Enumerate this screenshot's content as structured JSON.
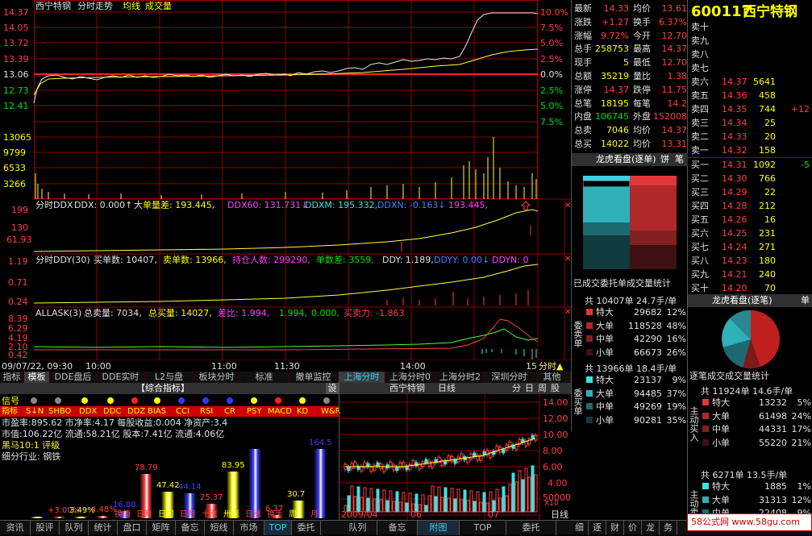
{
  "chart_title": {
    "name": "西宁特钢",
    "mode": "分时走势",
    "avg": "均线",
    "vol": "成交量"
  },
  "price_axis": [
    "14.37",
    "14.05",
    "13.72",
    "13.39",
    "13.06",
    "12.73",
    "12.41"
  ],
  "pct_axis": [
    "10.0%",
    "7.5%",
    "5.0%",
    "2.5%",
    "0.0%",
    "2.5%",
    "5.0%",
    "7.5%"
  ],
  "vol_axis": [
    "13065",
    "9799",
    "6533",
    "3266"
  ],
  "ddx_head": {
    "t": "分时DDX",
    "a": "DDX: 0.000↑",
    "b": "大单量差: 193.445,",
    "c": "DDX60: 131.731↓",
    "d": "DDXM: 195.332,",
    "e": "DDXN: -0.163↓",
    "f": "193.445,"
  },
  "ddx_axis": [
    "199",
    "130",
    "61.93"
  ],
  "ddy_head": {
    "t": "分时DDY(30)",
    "a": "买单数: 10407,",
    "b": "卖单数: 13966,",
    "c": "持仓人数: 299290,",
    "d": "单数差: 3559,",
    "e": "DDY: 1.189,",
    "f": "DDYY: 0.00↓",
    "g": "DDYN: 0"
  },
  "ddy_axis": [
    "1.19",
    "0.71",
    "0.24"
  ],
  "allask_head": {
    "t": "ALLASK(3)",
    "a": "总卖量: 7034,",
    "b": "总买量: 14027,",
    "c": "差比: 1.994,",
    "d": "1.994,",
    "e": "0.000,",
    "f": "买卖力: -1.863"
  },
  "allask_axis": [
    "8.39",
    "6.29",
    "4.19",
    "2.10",
    "0.42"
  ],
  "time_axis": {
    "date": "09/07/22, 09:30",
    "t1": "10:00",
    "t2": "11:00",
    "t3": "11:30",
    "t4": "14:00",
    "t5": "15",
    "end": "分时▲"
  },
  "tabs": [
    "指标",
    "模板",
    "DDE盘后",
    "DDE实时",
    "L2与盘",
    "板块分时",
    "标准",
    "撤单监控",
    "上海分时",
    "上海分时0",
    "上海分时2",
    "深圳分时",
    "其他"
  ],
  "quote": [
    {
      "a": "最新",
      "b": "14.33",
      "c": "均价",
      "d": "13.61"
    },
    {
      "a": "涨跌",
      "b": "+1.27",
      "c": "换手",
      "d": "6.37%"
    },
    {
      "a": "涨幅",
      "b": "9.72%",
      "c": "今开",
      "d": "12.70"
    },
    {
      "a": "总手",
      "b": "258753",
      "c": "最高",
      "d": "14.37"
    },
    {
      "a": "现手",
      "b": "5",
      "c": "最低",
      "d": "12.70"
    },
    {
      "a": "总额",
      "b": "35219",
      "c": "量比",
      "d": "1.38"
    },
    {
      "a": "涨停",
      "b": "14.37",
      "c": "跌停",
      "d": "11.75"
    },
    {
      "a": "总笔",
      "b": "18195",
      "c": "每笔",
      "d": "14.2"
    },
    {
      "a": "内盘",
      "b": "106745",
      "c": "外盘",
      "d": "152008"
    },
    {
      "a": "总卖",
      "b": "7046",
      "c": "均价",
      "d": "14.37"
    },
    {
      "a": "总买",
      "b": "14022",
      "c": "均价",
      "d": "13.31"
    }
  ],
  "stock": {
    "code": "600117",
    "name": "西宁特钢"
  },
  "sells": [
    {
      "l": "卖十",
      "p": "",
      "v": "",
      "x": ""
    },
    {
      "l": "卖九",
      "p": "",
      "v": "",
      "x": ""
    },
    {
      "l": "卖八",
      "p": "",
      "v": "",
      "x": ""
    },
    {
      "l": "卖七",
      "p": "",
      "v": "",
      "x": ""
    },
    {
      "l": "卖六",
      "p": "14.37",
      "v": "5641",
      "x": ""
    },
    {
      "l": "卖五",
      "p": "14.36",
      "v": "458",
      "x": ""
    },
    {
      "l": "卖四",
      "p": "14.35",
      "v": "744",
      "x": "+12"
    },
    {
      "l": "卖三",
      "p": "14.34",
      "v": "25",
      "x": ""
    },
    {
      "l": "卖二",
      "p": "14.33",
      "v": "20",
      "x": ""
    },
    {
      "l": "卖一",
      "p": "14.32",
      "v": "158",
      "x": ""
    }
  ],
  "buys": [
    {
      "l": "买一",
      "p": "14.31",
      "v": "1092",
      "x": "-5"
    },
    {
      "l": "买二",
      "p": "14.30",
      "v": "766",
      "x": ""
    },
    {
      "l": "买三",
      "p": "14.29",
      "v": "22",
      "x": ""
    },
    {
      "l": "买四",
      "p": "14.28",
      "v": "212",
      "x": ""
    },
    {
      "l": "买五",
      "p": "14.26",
      "v": "16",
      "x": ""
    },
    {
      "l": "买六",
      "p": "14.25",
      "v": "231",
      "x": ""
    },
    {
      "l": "买七",
      "p": "14.24",
      "v": "271",
      "x": ""
    },
    {
      "l": "买八",
      "p": "14.23",
      "v": "180",
      "x": ""
    },
    {
      "l": "买九",
      "p": "14.21",
      "v": "240",
      "x": ""
    },
    {
      "l": "买十",
      "p": "14.20",
      "v": "70",
      "x": ""
    }
  ],
  "dragon1": {
    "title": "龙虎看盘(逐单)",
    "tab": "饼",
    "tab2": "笔",
    "caption": "已成交委托单成交量统计"
  },
  "sell_orders": {
    "side": "委卖单",
    "head": "共 10407单 24.7手/单",
    "rows": [
      {
        "n": "特大",
        "v": "29682",
        "p": "12%"
      },
      {
        "n": "大单",
        "v": "118528",
        "p": "48%"
      },
      {
        "n": "中单",
        "v": "42290",
        "p": "16%"
      },
      {
        "n": "小单",
        "v": "66673",
        "p": "26%"
      }
    ]
  },
  "buy_orders": {
    "side": "委买单",
    "head": "共 13966单 18.4手/单",
    "rows": [
      {
        "n": "特大",
        "v": "23137",
        "p": "9%"
      },
      {
        "n": "大单",
        "v": "94485",
        "p": "37%"
      },
      {
        "n": "中单",
        "v": "49269",
        "p": "19%"
      },
      {
        "n": "小单",
        "v": "90281",
        "p": "35%"
      }
    ]
  },
  "dragon2": {
    "title": "龙虎看盘(逐笔)",
    "tab": "单",
    "caption": "逐笔成交成交量统计"
  },
  "active_buy": {
    "side": "主动买入",
    "head": "共 11924单 14.6手/单",
    "rows": [
      {
        "n": "特大",
        "v": "13232",
        "p": "5%"
      },
      {
        "n": "大单",
        "v": "61498",
        "p": "24%"
      },
      {
        "n": "中单",
        "v": "44331",
        "p": "17%"
      },
      {
        "n": "小单",
        "v": "55220",
        "p": "21%"
      }
    ]
  },
  "active_sell": {
    "side": "主动卖出",
    "head": "共 6271单 13.5手/单",
    "rows": [
      {
        "n": "特大",
        "v": "1885",
        "p": "1%"
      },
      {
        "n": "大单",
        "v": "31313",
        "p": "12%"
      },
      {
        "n": "中单",
        "v": "22408",
        "p": "9%"
      }
    ]
  },
  "indicator": {
    "title": "【综合指标】",
    "set": "设",
    "sig": "信号",
    "lab": "指标",
    "keys": [
      "S↓N",
      "SHBO",
      "DDX",
      "DDC",
      "DDZ",
      "BIAS",
      "CCI",
      "RSI",
      "CR",
      "PSY",
      "MACD",
      "KD",
      "W&R"
    ],
    "l1": "市盈率:895.62 市净率:4.17 每股收益:0.004 净资产:3.4",
    "l2": "市值:106.22亿 流通:58.21亿 股本:7.41亿 流通:4.06亿",
    "l3": "黑马10:1 评级",
    "l4": "细分行业: 钢铁",
    "bars": [
      {
        "top": "",
        "bot": "",
        "h": 0.01,
        "c": "#ffff00"
      },
      {
        "top": "+3.00%",
        "bot": "",
        "h": 0.02,
        "c": "#ff4040"
      },
      {
        "top": "3.49%",
        "bot": "",
        "h": 0.02,
        "c": "#ffff00"
      },
      {
        "top": "4.48%",
        "bot": "",
        "h": 0.03,
        "c": "#ff4040"
      },
      {
        "top": "16.80",
        "bot": "换值",
        "h": 0.08,
        "c": "#4040ff"
      },
      {
        "top": "78.79",
        "bot": "日月",
        "h": 0.5,
        "c": "#ff4040"
      },
      {
        "top": "47.42",
        "bot": "日周",
        "h": 0.3,
        "c": "#ffff00"
      },
      {
        "top": "44.14",
        "bot": "日月",
        "h": 0.28,
        "c": "#4040ff"
      },
      {
        "top": "25.37",
        "bot": "十涨",
        "h": 0.16,
        "c": "#ff4040"
      },
      {
        "top": "83.95",
        "bot": "卅涨",
        "h": 0.53,
        "c": "#ffff00"
      },
      {
        "top": "",
        "bot": "日涨",
        "h": 0.78,
        "c": "#4040ff"
      },
      {
        "top": "6.37",
        "bot": "换手",
        "h": 0.04,
        "c": "#ff4040"
      },
      {
        "top": "30.7",
        "bot": "周",
        "h": 0.2,
        "c": "#ffff00"
      },
      {
        "top": "164.5",
        "bot": "月",
        "h": 0.78,
        "c": "#4040ff"
      }
    ]
  },
  "kline": {
    "title": "西宁特钢",
    "period": "日线",
    "btns": [
      "分",
      "日",
      "周",
      "股"
    ],
    "axis": [
      "14.00",
      "12.00",
      "10.00",
      "8.00",
      "6.00",
      "4.00",
      "50000",
      "0",
      "X10"
    ],
    "dates": [
      "2009/04",
      "06",
      "07"
    ],
    "end": "日线"
  },
  "bottom": [
    "资讯",
    "股评",
    "队列",
    "统计",
    "盘口",
    "矩阵",
    "备忘",
    "短线",
    "市场",
    "TOP",
    "委托",
    "队列",
    "备忘",
    "附图",
    "TOP",
    "委托",
    "细",
    "逐",
    "财",
    "价",
    "龙",
    "务"
  ],
  "watermark": "58公式网 www.58gu.com",
  "colors": {
    "up": "#ff4040",
    "down": "#00e0e0",
    "grid": "#a00000",
    "yellow": "#ffff00"
  }
}
